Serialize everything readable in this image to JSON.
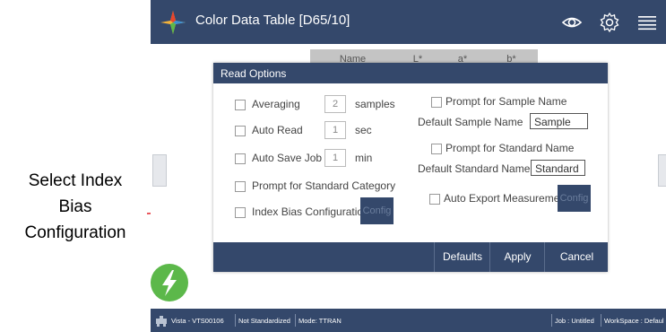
{
  "annotation": {
    "text": "Select Index\nBias\nConfiguration"
  },
  "app": {
    "title": "Color Data Table [D65/10]"
  },
  "background_table": {
    "columns": [
      "Name",
      "L*",
      "a*",
      "b*"
    ]
  },
  "dialog": {
    "title": "Read Options",
    "averaging": {
      "label": "Averaging",
      "value": "2",
      "unit": "samples"
    },
    "auto_read": {
      "label": "Auto Read",
      "value": "1",
      "unit": "sec"
    },
    "auto_save": {
      "label": "Auto Save Job",
      "value": "1",
      "unit": "min"
    },
    "prompt_std_category": {
      "label": "Prompt for Standard Category"
    },
    "index_bias": {
      "label": "Index Bias Configuration",
      "config_label": "Config"
    },
    "prompt_sample_name": {
      "label": "Prompt for Sample Name"
    },
    "default_sample_name": {
      "label": "Default Sample Name",
      "value": "Sample"
    },
    "prompt_std_name": {
      "label": "Prompt for Standard Name"
    },
    "default_std_name": {
      "label": "Default Standard Name",
      "value": "Standard"
    },
    "auto_export": {
      "label": "Auto Export Measurement",
      "config_label": "Config"
    },
    "buttons": {
      "defaults": "Defaults",
      "apply": "Apply",
      "cancel": "Cancel"
    }
  },
  "status_bar": {
    "instrument": "Vista - VTS00106",
    "standardized": "Not Standardized",
    "mode": "Mode: TTRAN",
    "job": "Job : Untitled",
    "workspace": "WorkSpace : Defaul"
  },
  "icons": [
    "app-logo-icon",
    "eye-icon",
    "gear-icon",
    "menu-icon",
    "lightning-icon",
    "instrument-icon"
  ],
  "colors": {
    "header": "#34486b",
    "accent_green": "#5cb84a",
    "annotation_red": "#e3232a"
  }
}
